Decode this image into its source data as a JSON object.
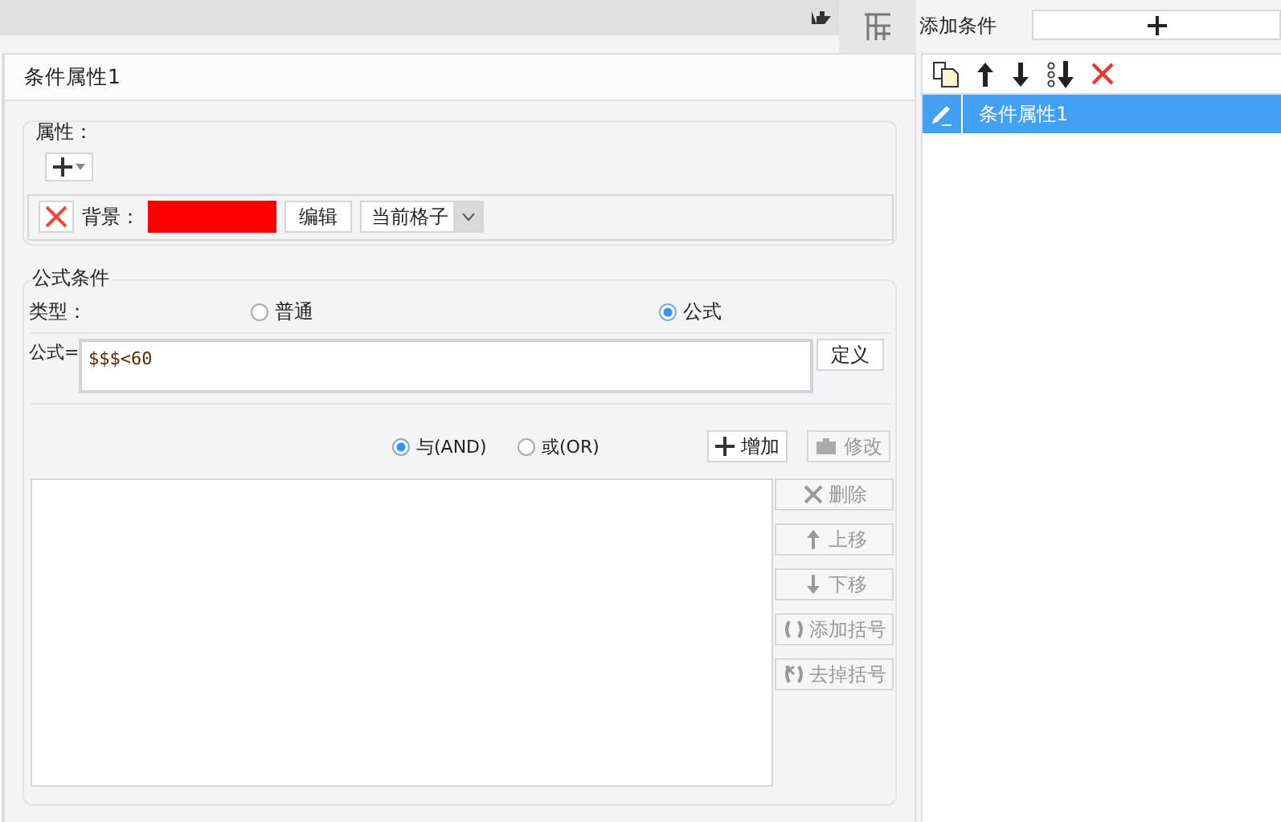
{
  "dialog": {
    "title": "条件属性1",
    "attributes": {
      "legend": "属性：",
      "background_label": "背景：",
      "color": "#ff0000",
      "edit_button": "编辑",
      "scope": "当前格子"
    },
    "formula_condition": {
      "legend": "公式条件",
      "type_label": "类型：",
      "types": [
        {
          "label": "普通",
          "selected": false
        },
        {
          "label": "公式",
          "selected": true
        }
      ],
      "formula_label": "公式=",
      "formula": "$$$<60",
      "define_button": "定义",
      "logic": [
        {
          "label": "与(AND)",
          "selected": true
        },
        {
          "label": "或(OR)",
          "selected": false
        }
      ],
      "add_button": "增加",
      "modify_button": {
        "label": "修改",
        "disabled": true
      },
      "actions": [
        {
          "kind": "delete",
          "label": "删除",
          "disabled": true
        },
        {
          "kind": "up",
          "label": "上移",
          "disabled": true
        },
        {
          "kind": "down",
          "label": "下移",
          "disabled": true
        },
        {
          "kind": "add-brackets",
          "label": "添加括号",
          "disabled": true
        },
        {
          "kind": "remove-brackets",
          "label": "去掉括号",
          "disabled": true
        }
      ]
    }
  },
  "conditions_panel": {
    "add_label": "添加条件",
    "items": [
      {
        "label": "条件属性1",
        "selected": true
      }
    ]
  }
}
